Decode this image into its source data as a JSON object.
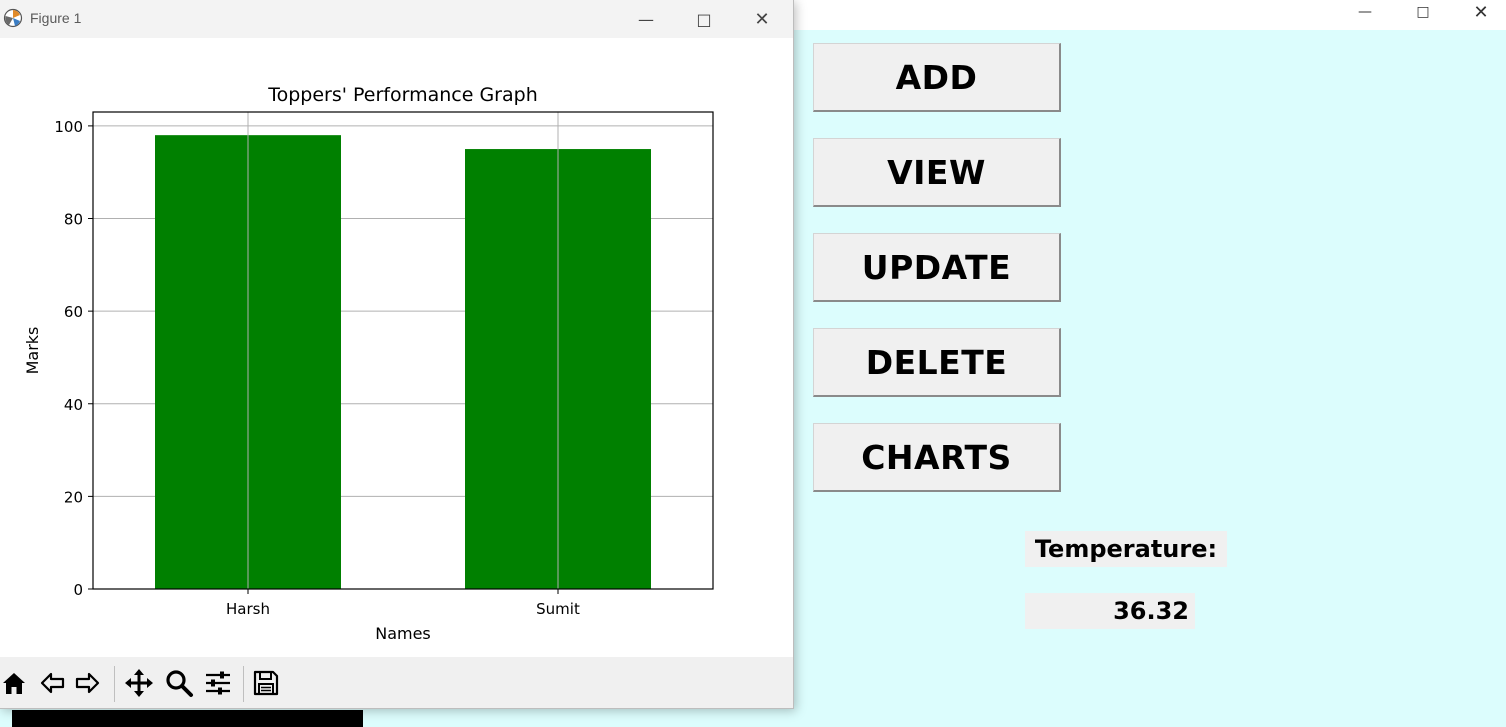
{
  "app": {
    "buttons": [
      {
        "label": "ADD"
      },
      {
        "label": "VIEW"
      },
      {
        "label": "UPDATE"
      },
      {
        "label": "DELETE"
      },
      {
        "label": "CHARTS"
      }
    ],
    "temperature_label": "Temperature:",
    "temperature_value": "36.32",
    "background_color": "#dcfdfd"
  },
  "figure_window": {
    "title": "Figure 1",
    "toolbar_icons": [
      "home-icon",
      "back-icon",
      "forward-icon",
      "pan-icon",
      "zoom-icon",
      "configure-subplots-icon",
      "save-icon"
    ]
  },
  "chart_data": {
    "type": "bar",
    "title": "Toppers' Performance Graph",
    "xlabel": "Names",
    "ylabel": "Marks",
    "categories": [
      "Harsh",
      "Sumit"
    ],
    "values": [
      98,
      95
    ],
    "ylim": [
      0,
      103
    ],
    "yticks": [
      0,
      20,
      40,
      60,
      80,
      100
    ],
    "bar_color": "#008000",
    "grid": true
  }
}
